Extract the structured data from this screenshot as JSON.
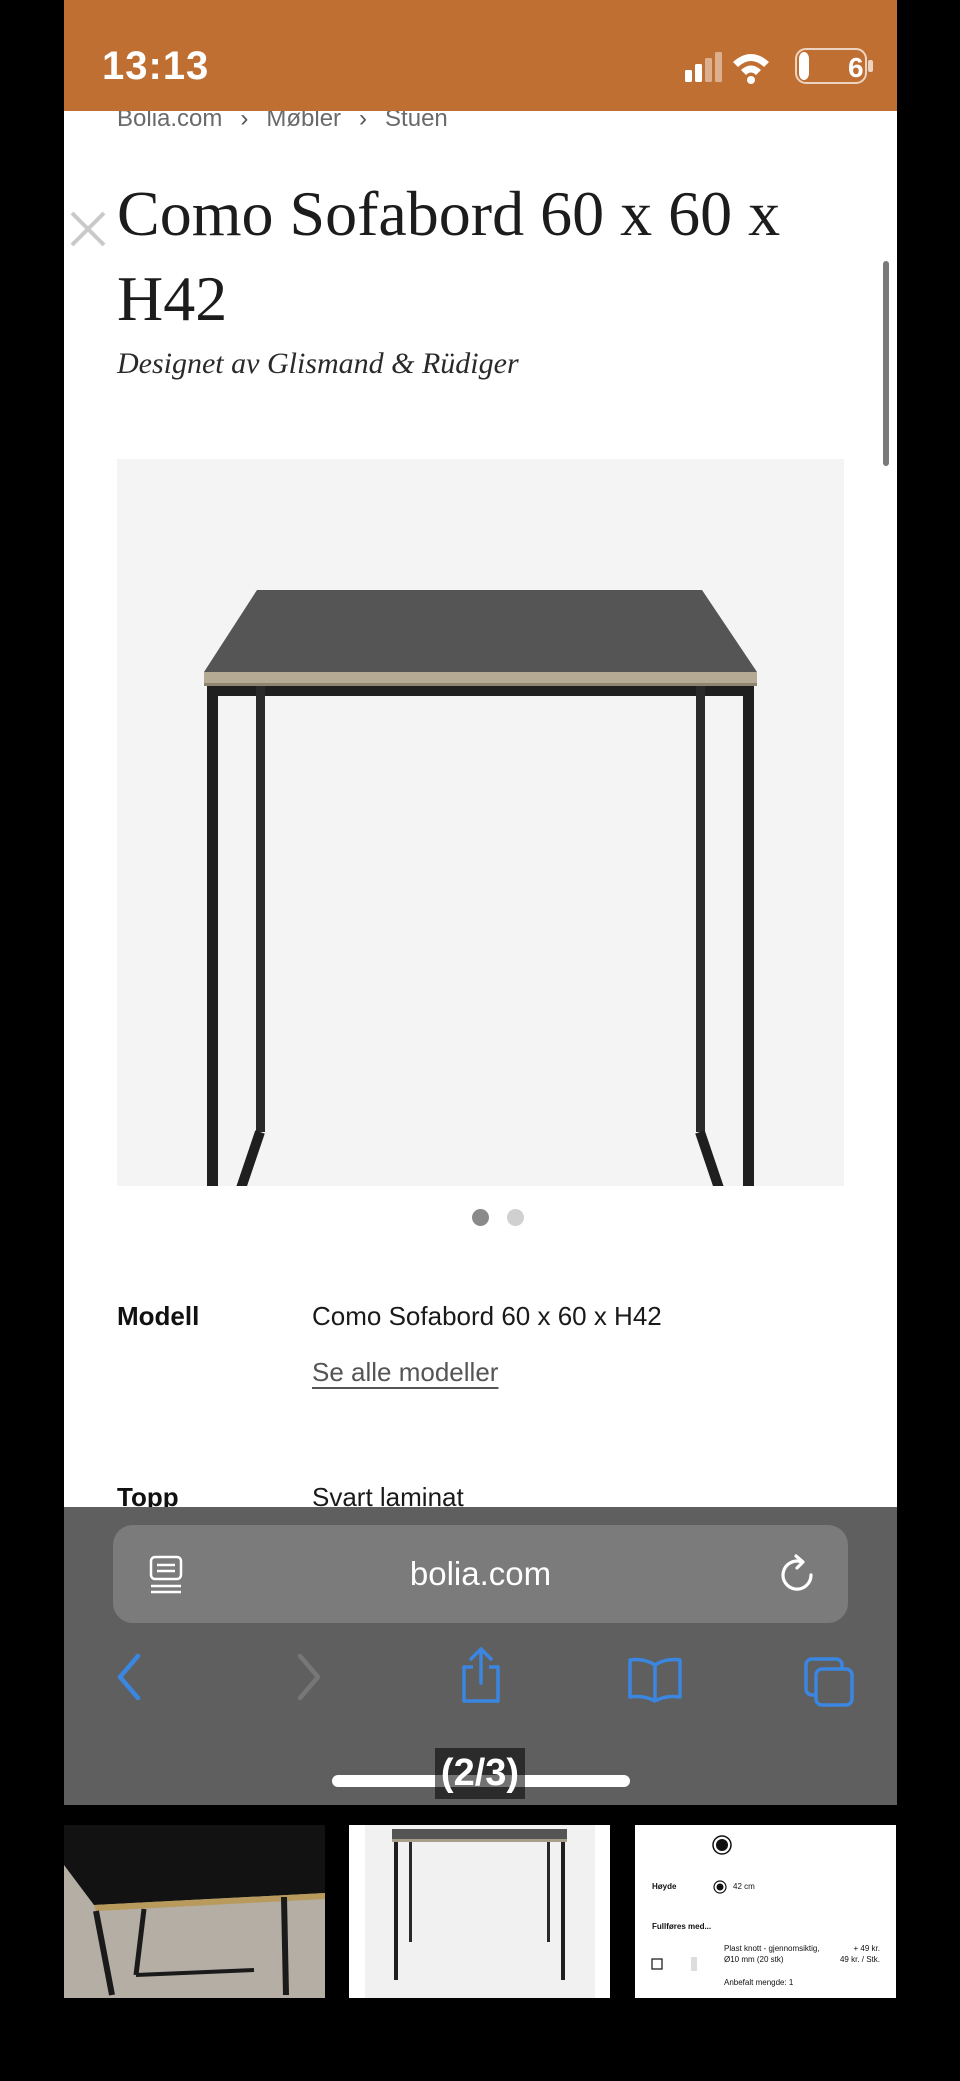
{
  "status_bar": {
    "time": "13:13",
    "battery": "6",
    "background": "#c06f32"
  },
  "breadcrumb": [
    "Bolia.com",
    "Møbler",
    "Stuen"
  ],
  "product": {
    "title": "Como Sofabord 60 x 60 x H42",
    "designer": "Designet av Glismand & Rüdiger",
    "image_count": 2,
    "active_image": 1
  },
  "specs": [
    {
      "label": "Modell",
      "value": "Como Sofabord 60 x 60 x H42",
      "link": "Se alle modeller"
    },
    {
      "label": "Topp",
      "value": "Svart laminat"
    }
  ],
  "browser": {
    "url": "bolia.com",
    "icons": [
      "reader-icon",
      "reload-icon",
      "back-icon",
      "forward-icon",
      "share-icon",
      "bookmarks-icon",
      "tabs-icon"
    ],
    "accent": "#3a86e0"
  },
  "gallery": {
    "counter": "(2/3)",
    "thumbnails": [
      {
        "name": "photo-table-on-floor"
      },
      {
        "name": "product-image-table"
      },
      {
        "name": "options-screenshot",
        "hoyde_label": "Høyde",
        "hoyde_value": "42 cm",
        "finish_label": "Fullføres med...",
        "addon_name": "Plast knott - gjennomsiktig, Ø10 mm (20 stk)",
        "addon_price": "+ 49 kr.",
        "addon_unit_price": "49 kr. / Stk.",
        "addon_recommended": "Anbefalt mengde: 1"
      }
    ]
  }
}
